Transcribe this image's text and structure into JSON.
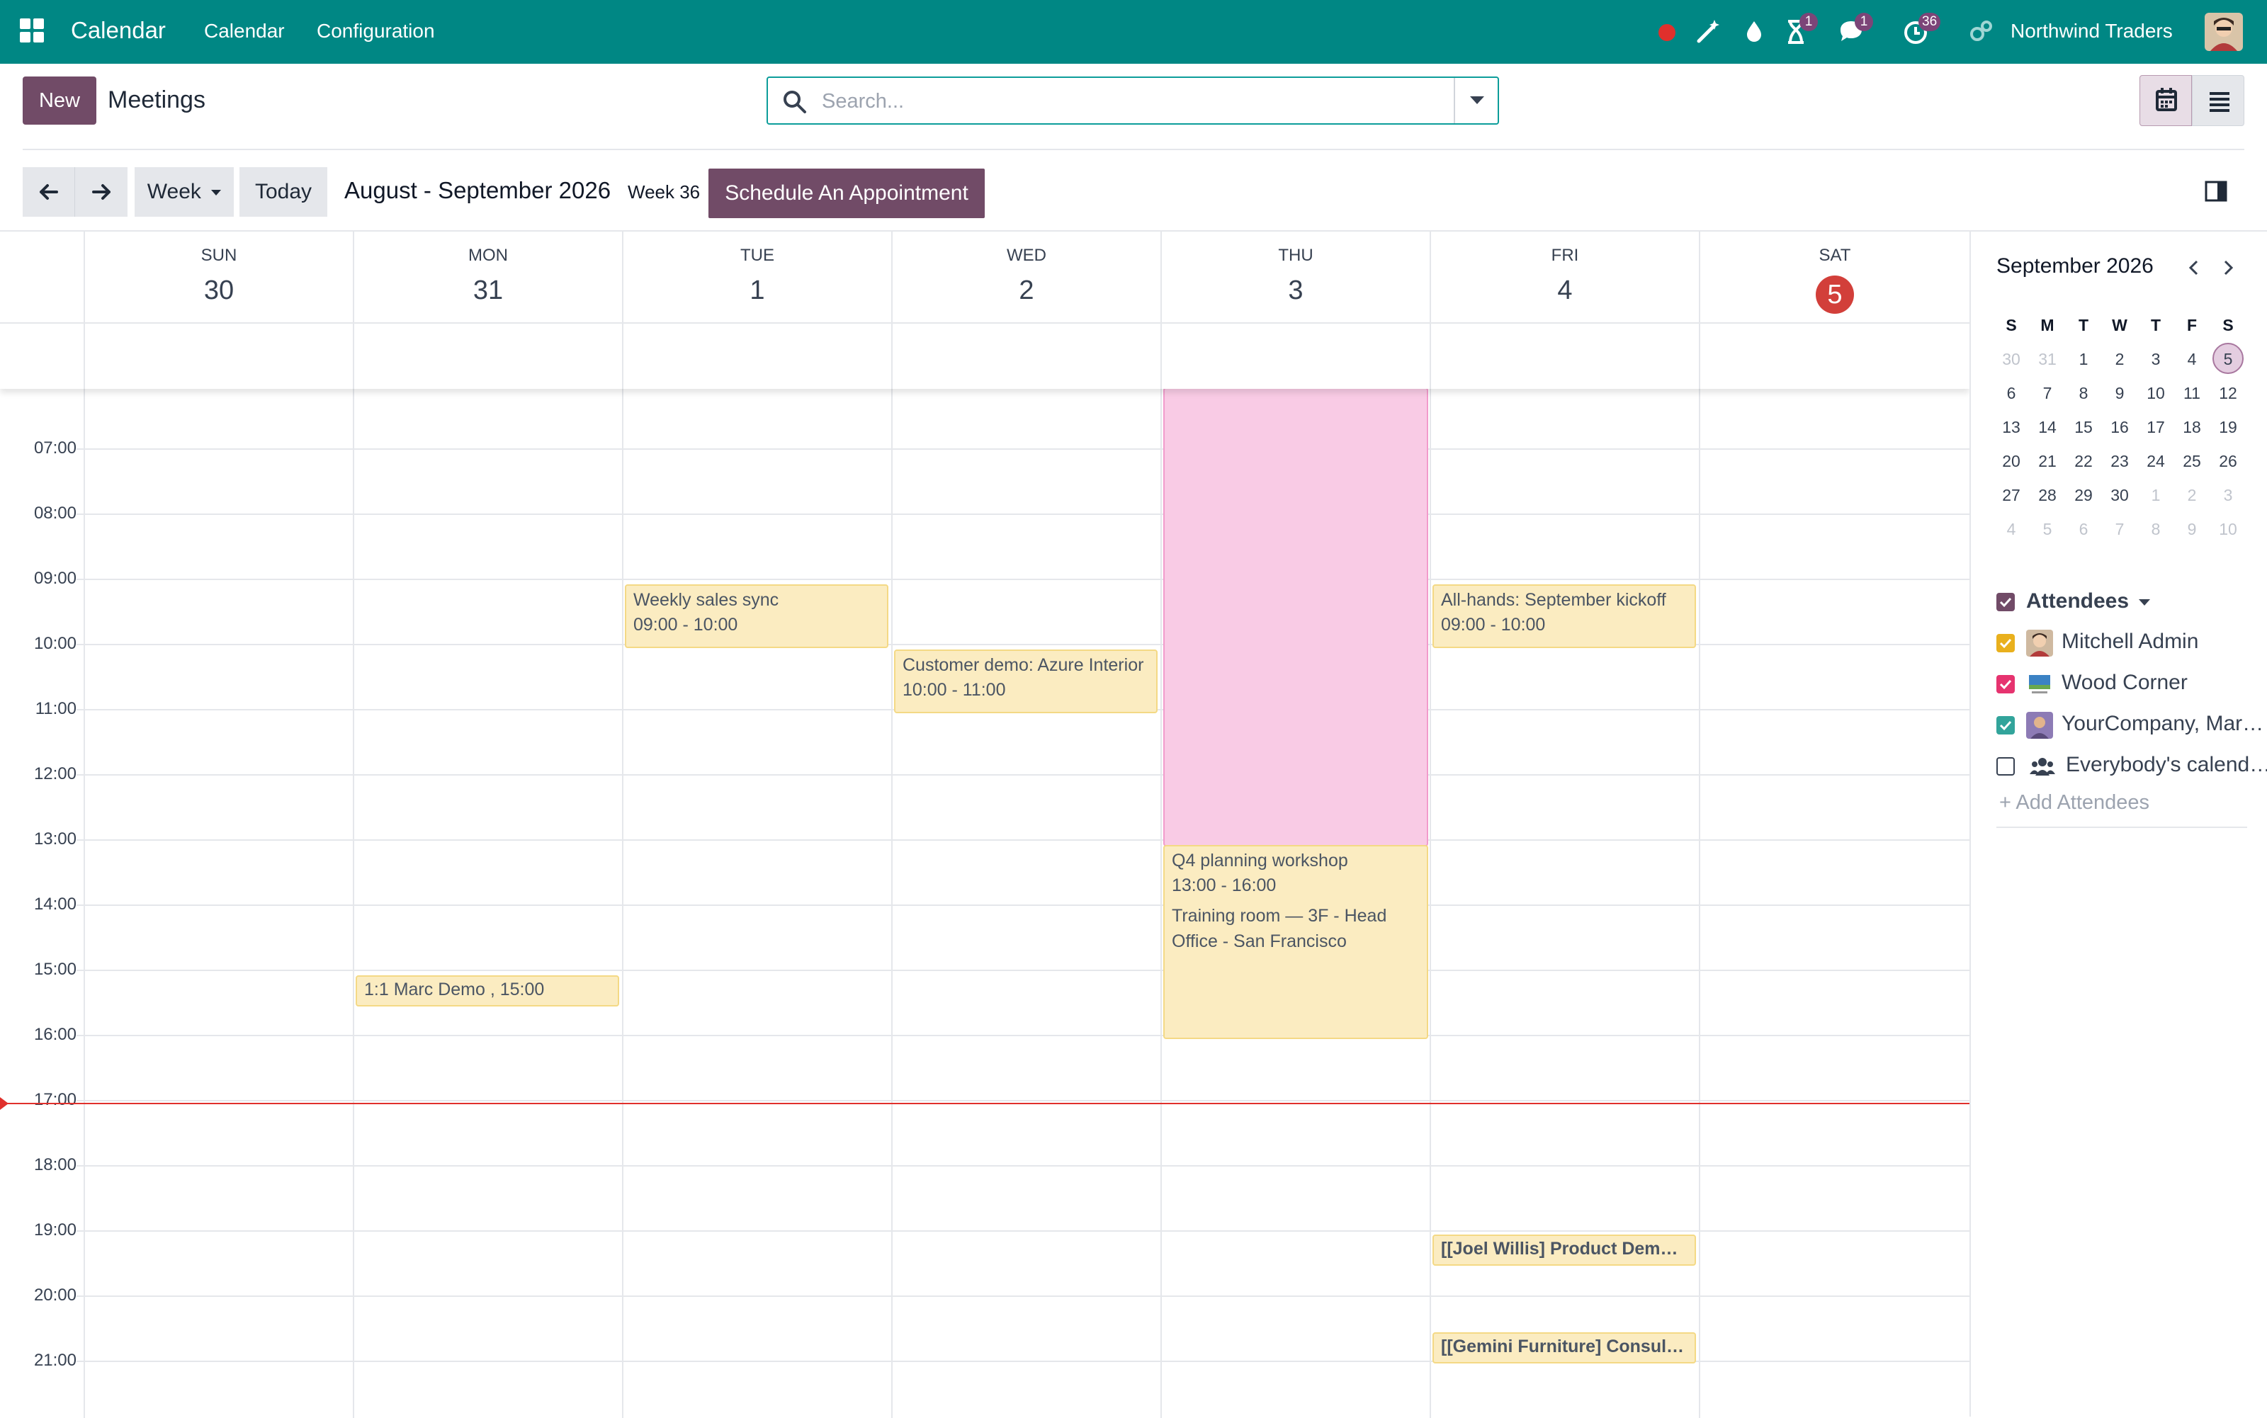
{
  "topbar": {
    "app_name": "Calendar",
    "menu": [
      "Calendar",
      "Configuration"
    ],
    "company": "Northwind Traders",
    "activity_badge": "1",
    "messages_badge": "1",
    "timer_badge": "36",
    "color": "#008784"
  },
  "control": {
    "new_label": "New",
    "breadcrumb": "Meetings",
    "search_placeholder": "Search..."
  },
  "toolbar": {
    "scale_label": "Week",
    "today_label": "Today",
    "range_title": "August - September 2026",
    "week_label": "Week 36",
    "appointment_label": "Schedule An Appointment"
  },
  "days": [
    {
      "name": "SUN",
      "num": "30"
    },
    {
      "name": "MON",
      "num": "31"
    },
    {
      "name": "TUE",
      "num": "1"
    },
    {
      "name": "WED",
      "num": "2"
    },
    {
      "name": "THU",
      "num": "3"
    },
    {
      "name": "FRI",
      "num": "4"
    },
    {
      "name": "SAT",
      "num": "5",
      "today": true
    }
  ],
  "hours": [
    "07:00",
    "08:00",
    "09:00",
    "10:00",
    "11:00",
    "12:00",
    "13:00",
    "14:00",
    "15:00",
    "16:00",
    "17:00",
    "18:00",
    "19:00",
    "20:00",
    "21:00"
  ],
  "events": {
    "weekly_sales": {
      "title": "Weekly sales sync",
      "time": "09:00 - 10:00"
    },
    "customer_demo": {
      "title": "Customer demo: Azure Interior",
      "time": "10:00 - 11:00"
    },
    "allhands": {
      "title": "All-hands: September kickoff",
      "time": "09:00 - 10:00"
    },
    "q4": {
      "title": "Q4 planning workshop",
      "time": "13:00 - 16:00",
      "location": "Training room — 3F - Head Office - San Francisco"
    },
    "marc_demo": {
      "title": "1:1 Marc Demo , 15:00"
    },
    "joel": {
      "title": "[[Joel Willis] Product Demonstration"
    },
    "gemini": {
      "title": "[[Gemini Furniture] Consulting"
    }
  },
  "mini_calendar": {
    "title": "September 2026",
    "weekdays": [
      "S",
      "M",
      "T",
      "W",
      "T",
      "F",
      "S"
    ],
    "weeks": [
      [
        "30",
        "31",
        "1",
        "2",
        "3",
        "4",
        "5"
      ],
      [
        "6",
        "7",
        "8",
        "9",
        "10",
        "11",
        "12"
      ],
      [
        "13",
        "14",
        "15",
        "16",
        "17",
        "18",
        "19"
      ],
      [
        "20",
        "21",
        "22",
        "23",
        "24",
        "25",
        "26"
      ],
      [
        "27",
        "28",
        "29",
        "30",
        "1",
        "2",
        "3"
      ],
      [
        "4",
        "5",
        "6",
        "7",
        "8",
        "9",
        "10"
      ]
    ]
  },
  "attendees": {
    "heading": "Attendees",
    "people": [
      {
        "name": "Mitchell Admin",
        "color": "#e9b01d",
        "checked": true
      },
      {
        "name": "Wood Corner",
        "color": "#e6336f",
        "checked": true
      },
      {
        "name": "YourCompany, Marc Demo",
        "color": "#32a49b",
        "checked": true
      },
      {
        "name": "Everybody's calendars",
        "color": "#ffffff",
        "checked": false
      }
    ],
    "add_label": "+ Add Attendees"
  }
}
